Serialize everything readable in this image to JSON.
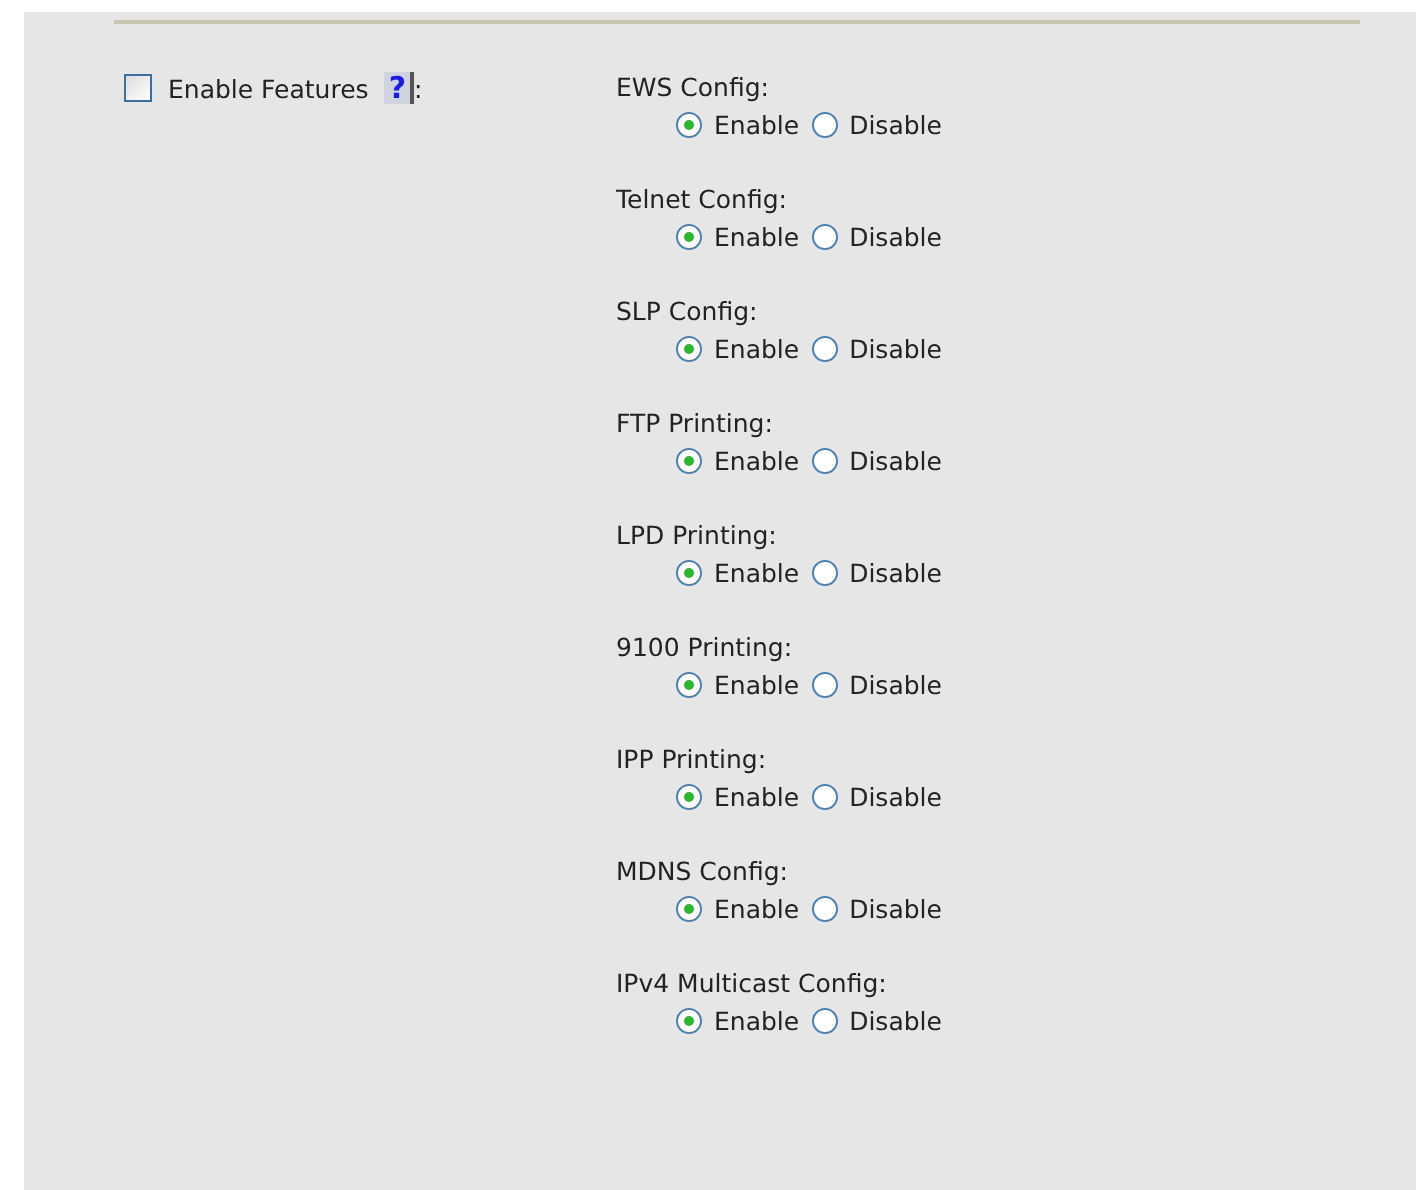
{
  "enable_features": {
    "label": "Enable Features",
    "colon": ":",
    "help": "?",
    "checked": false
  },
  "settings": [
    {
      "label": "EWS Config:",
      "options": [
        {
          "label": "Enable",
          "selected": true
        },
        {
          "label": "Disable",
          "selected": false
        }
      ]
    },
    {
      "label": "Telnet Config:",
      "options": [
        {
          "label": "Enable",
          "selected": true
        },
        {
          "label": "Disable",
          "selected": false
        }
      ]
    },
    {
      "label": "SLP Config:",
      "options": [
        {
          "label": "Enable",
          "selected": true
        },
        {
          "label": "Disable",
          "selected": false
        }
      ]
    },
    {
      "label": "FTP Printing:",
      "options": [
        {
          "label": "Enable",
          "selected": true
        },
        {
          "label": "Disable",
          "selected": false
        }
      ]
    },
    {
      "label": "LPD Printing:",
      "options": [
        {
          "label": "Enable",
          "selected": true
        },
        {
          "label": "Disable",
          "selected": false
        }
      ]
    },
    {
      "label": "9100 Printing:",
      "options": [
        {
          "label": "Enable",
          "selected": true
        },
        {
          "label": "Disable",
          "selected": false
        }
      ]
    },
    {
      "label": "IPP Printing:",
      "options": [
        {
          "label": "Enable",
          "selected": true
        },
        {
          "label": "Disable",
          "selected": false
        }
      ]
    },
    {
      "label": "MDNS Config:",
      "options": [
        {
          "label": "Enable",
          "selected": true
        },
        {
          "label": "Disable",
          "selected": false
        }
      ]
    },
    {
      "label": "IPv4 Multicast Config:",
      "options": [
        {
          "label": "Enable",
          "selected": true
        },
        {
          "label": "Disable",
          "selected": false
        }
      ]
    }
  ]
}
